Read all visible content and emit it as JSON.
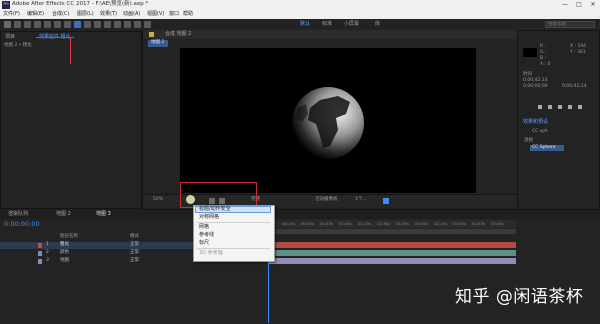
{
  "app": {
    "title": "Adobe After Effects CC 2017 - F:\\AE\\预览(新).aep *",
    "logo": "Ae"
  },
  "window_controls": [
    "—",
    "□",
    "✕"
  ],
  "menu": [
    "文件(F)",
    "编辑(E)",
    "合成(C)",
    "图层(L)",
    "效果(T)",
    "动画(A)",
    "视图(V)",
    "窗口",
    "帮助"
  ],
  "toolbar": {
    "workspace_links": [
      "默认",
      "标准",
      "小屏幕",
      "库"
    ],
    "search_placeholder": "搜索帮助"
  },
  "project_panel": {
    "tabs": [
      "项目",
      "效果控件 粗化"
    ],
    "breadcrumb": "地图 2 • 粗化"
  },
  "composition_panel": {
    "tab_label": "合成 地图 2",
    "subtab": "地图 2"
  },
  "viewer_controls": {
    "zoom": "50%",
    "resolution": "完整",
    "camera": "活动摄像机",
    "views": "1个..."
  },
  "context_menu": {
    "items": [
      {
        "label": "标题/动作安全",
        "highlighted": true,
        "enabled": true
      },
      {
        "label": "对称网格",
        "highlighted": false,
        "enabled": true
      },
      {
        "label": "网格",
        "highlighted": false,
        "enabled": true
      },
      {
        "label": "参考线",
        "highlighted": false,
        "enabled": true
      },
      {
        "label": "标尺",
        "highlighted": false,
        "enabled": true
      },
      {
        "label": "3D 参考轴",
        "highlighted": false,
        "enabled": false
      }
    ]
  },
  "right_panel": {
    "info_lines": [
      "R :",
      "G :",
      "B :",
      "A : 0",
      "X : 194",
      "Y : 361"
    ],
    "time_label": "时间",
    "times": [
      "0;00;42;14",
      "0;00;00;00",
      "0;00;42;14"
    ],
    "effects_tab": "效果和预设",
    "effect_group": "CC sph",
    "effect_parent": "透视",
    "effect_item": "CC Sphere"
  },
  "timeline": {
    "tabs": [
      "渲染队列",
      "地图 2",
      "地图 3"
    ],
    "timecode": "0:00:00:00",
    "header": [
      "图层名称",
      "模式"
    ],
    "layers": [
      {
        "num": "1",
        "name": "粗化",
        "mode": "正常",
        "color": "#c74a3e"
      },
      {
        "num": "2",
        "name": "颜色",
        "mode": "正常",
        "color": "#7c8fb8"
      },
      {
        "num": "3",
        "name": "地图",
        "mode": "正常",
        "color": "#8a8ac0"
      }
    ],
    "ruler": [
      "00:15s",
      "00:30s",
      "00:45s",
      "01:00s",
      "01:15s",
      "01:30s",
      "01:45s",
      "02:00s",
      "02:15s",
      "02:30s",
      "02:45s",
      "03:00s",
      "03:15s"
    ]
  },
  "watermark": "知乎 @闲语茶杯",
  "colors": {
    "accent": "#3d8cff",
    "highlight_red": "#c73030",
    "layer_bar_red": "#b14a44",
    "layer_bar_teal": "#5f8f86",
    "layer_bar_purple": "#8f8fb4"
  }
}
